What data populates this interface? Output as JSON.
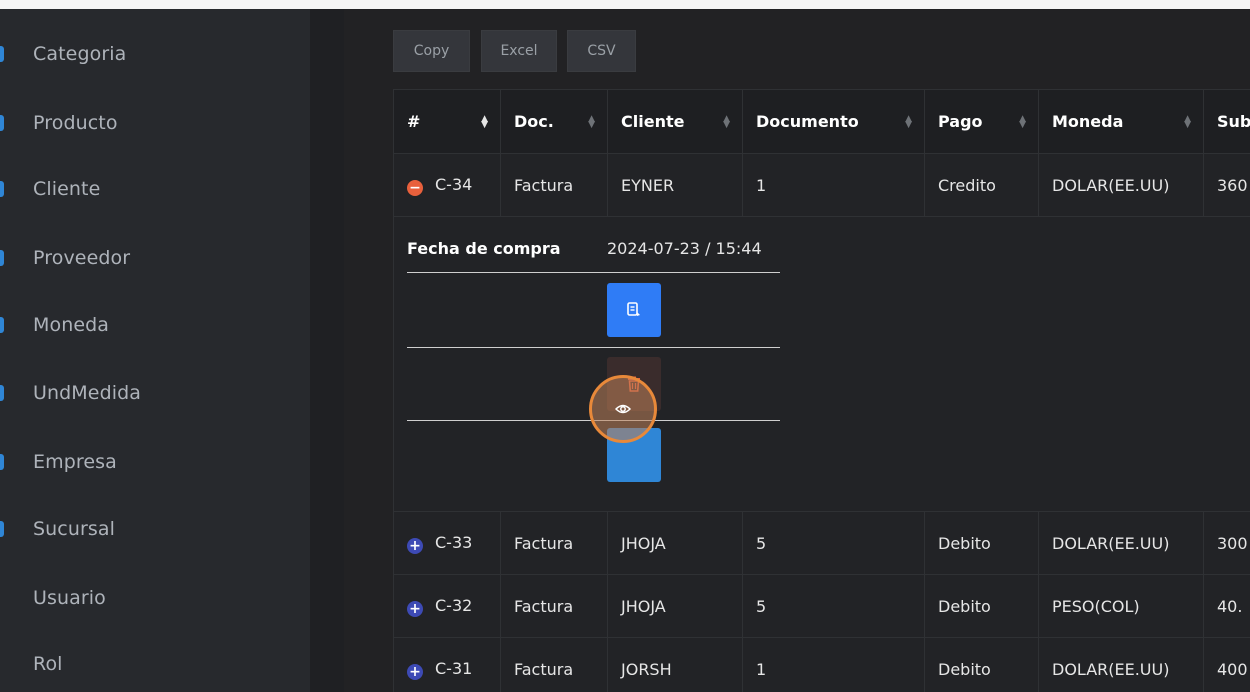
{
  "sidebar": {
    "items": [
      {
        "label": "Categoria"
      },
      {
        "label": "Producto"
      },
      {
        "label": "Cliente"
      },
      {
        "label": "Proveedor"
      },
      {
        "label": "Moneda"
      },
      {
        "label": "UndMedida"
      },
      {
        "label": "Empresa"
      },
      {
        "label": "Sucursal"
      },
      {
        "label": "Usuario"
      },
      {
        "label": "Rol"
      }
    ]
  },
  "toolbar": {
    "copy_label": "Copy",
    "excel_label": "Excel",
    "csv_label": "CSV"
  },
  "table": {
    "headers": [
      "#",
      "Doc.",
      "Cliente",
      "Documento",
      "Pago",
      "Moneda",
      "Sub"
    ],
    "rows": [
      {
        "id": "C-34",
        "doc": "Factura",
        "cliente": "EYNER",
        "documento": "1",
        "pago": "Credito",
        "moneda": "DOLAR(EE.UU)",
        "sub": "360",
        "expanded": true
      },
      {
        "id": "C-33",
        "doc": "Factura",
        "cliente": "JHOJA",
        "documento": "5",
        "pago": "Debito",
        "moneda": "DOLAR(EE.UU)",
        "sub": "300",
        "expanded": false
      },
      {
        "id": "C-32",
        "doc": "Factura",
        "cliente": "JHOJA",
        "documento": "5",
        "pago": "Debito",
        "moneda": "PESO(COL)",
        "sub": "40.",
        "expanded": false
      },
      {
        "id": "C-31",
        "doc": "Factura",
        "cliente": "JORSH",
        "documento": "1",
        "pago": "Debito",
        "moneda": "DOLAR(EE.UU)",
        "sub": "400",
        "expanded": false
      }
    ],
    "detail": {
      "fecha_label": "Fecha de compra",
      "fecha_value": "2024-07-23 / 15:44"
    }
  },
  "colors": {
    "accent_blue": "#2f7cf6",
    "danger": "#e8603c",
    "expand_plus": "#3d4ab5",
    "click_highlight": "#e8893a"
  },
  "icons": {
    "edit": "document-edit-icon",
    "delete": "trash-icon",
    "view": "eye-icon"
  }
}
